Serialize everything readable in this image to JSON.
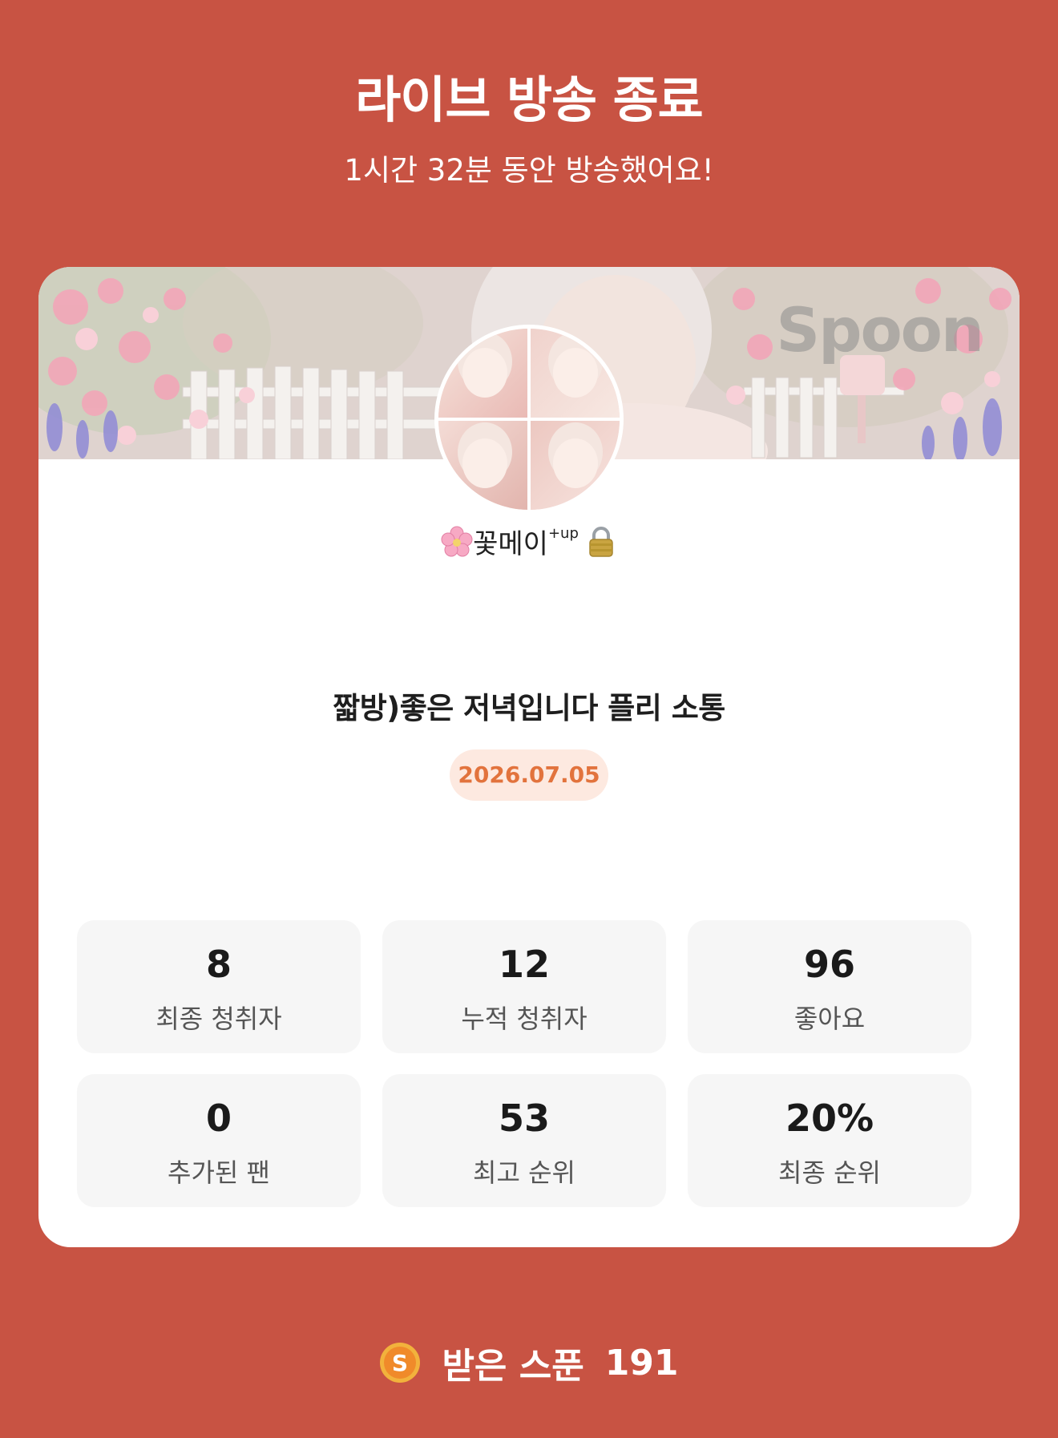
{
  "header": {
    "title": "라이브 방송 종료",
    "subtitle": "1시간 32분 동안 방송했어요!"
  },
  "card": {
    "watermark": "Spoon",
    "nickname": "꽃메이",
    "nickname_sup": "+up",
    "broadcast_title": "짧방)좋은 저녁입니다 플리 소통",
    "date": "2026.07.05",
    "stats": [
      {
        "value": "8",
        "label": "최종 청취자"
      },
      {
        "value": "12",
        "label": "누적 청취자"
      },
      {
        "value": "96",
        "label": "좋아요"
      },
      {
        "value": "0",
        "label": "추가된 팬"
      },
      {
        "value": "53",
        "label": "최고 순위"
      },
      {
        "value": "20%",
        "label": "최종 순위"
      }
    ]
  },
  "footer": {
    "label": "받은 스푼",
    "value": "191"
  },
  "colors": {
    "background": "#c85343",
    "card": "#ffffff",
    "date_text": "#e2733d",
    "date_bg": "#fde9e0",
    "coin": "#f0a030"
  }
}
